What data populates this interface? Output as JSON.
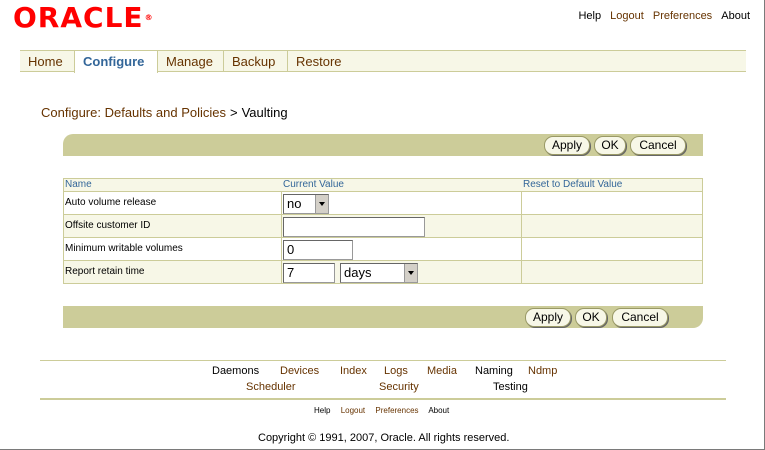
{
  "brand": {
    "logo": "ORACLE",
    "reg": "®",
    "color": "#ff0000"
  },
  "global_links": [
    {
      "label": "Help",
      "active": true
    },
    {
      "label": "Logout",
      "active": false
    },
    {
      "label": "Preferences",
      "active": false
    },
    {
      "label": "About",
      "active": true
    }
  ],
  "tabs": [
    {
      "label": "Home",
      "selected": false
    },
    {
      "label": "Configure",
      "selected": true
    },
    {
      "label": "Manage",
      "selected": false
    },
    {
      "label": "Backup",
      "selected": false
    },
    {
      "label": "Restore",
      "selected": false
    }
  ],
  "breadcrumb": {
    "parent": "Configure: Defaults and Policies",
    "separator": ">",
    "current": "Vaulting"
  },
  "buttons": {
    "apply": "Apply",
    "ok": "OK",
    "cancel": "Cancel"
  },
  "table": {
    "headers": {
      "name": "Name",
      "value": "Current Value",
      "reset": "Reset to Default Value"
    },
    "rows": [
      {
        "name": "Auto volume release",
        "value": "no",
        "type": "select"
      },
      {
        "name": "Offsite customer ID",
        "value": "",
        "type": "text"
      },
      {
        "name": "Minimum writable volumes",
        "value": "0",
        "type": "text"
      },
      {
        "name": "Report retain time",
        "value": "7",
        "unit": "days",
        "type": "text+select"
      }
    ]
  },
  "footer_nav": {
    "row1": [
      {
        "label": "Daemons",
        "active": true
      },
      {
        "label": "Devices",
        "active": false
      },
      {
        "label": "Index",
        "active": false
      },
      {
        "label": "Logs",
        "active": false
      },
      {
        "label": "Media",
        "active": false
      },
      {
        "label": "Naming",
        "active": true
      },
      {
        "label": "Ndmp",
        "active": false
      }
    ],
    "row2": [
      {
        "label": "Scheduler",
        "active": false
      },
      {
        "label": "Security",
        "active": false
      },
      {
        "label": "Testing",
        "active": true
      }
    ]
  },
  "footer_small": [
    {
      "label": "Help",
      "active": true
    },
    {
      "label": "Logout",
      "active": false
    },
    {
      "label": "Preferences",
      "active": false
    },
    {
      "label": "About",
      "active": true
    }
  ],
  "copyright": "Copyright © 1991, 2007, Oracle. All rights reserved.",
  "colors": {
    "accent": "#336699",
    "link": "#663300",
    "bar": "#cccc99",
    "light": "#f7f7e7"
  }
}
